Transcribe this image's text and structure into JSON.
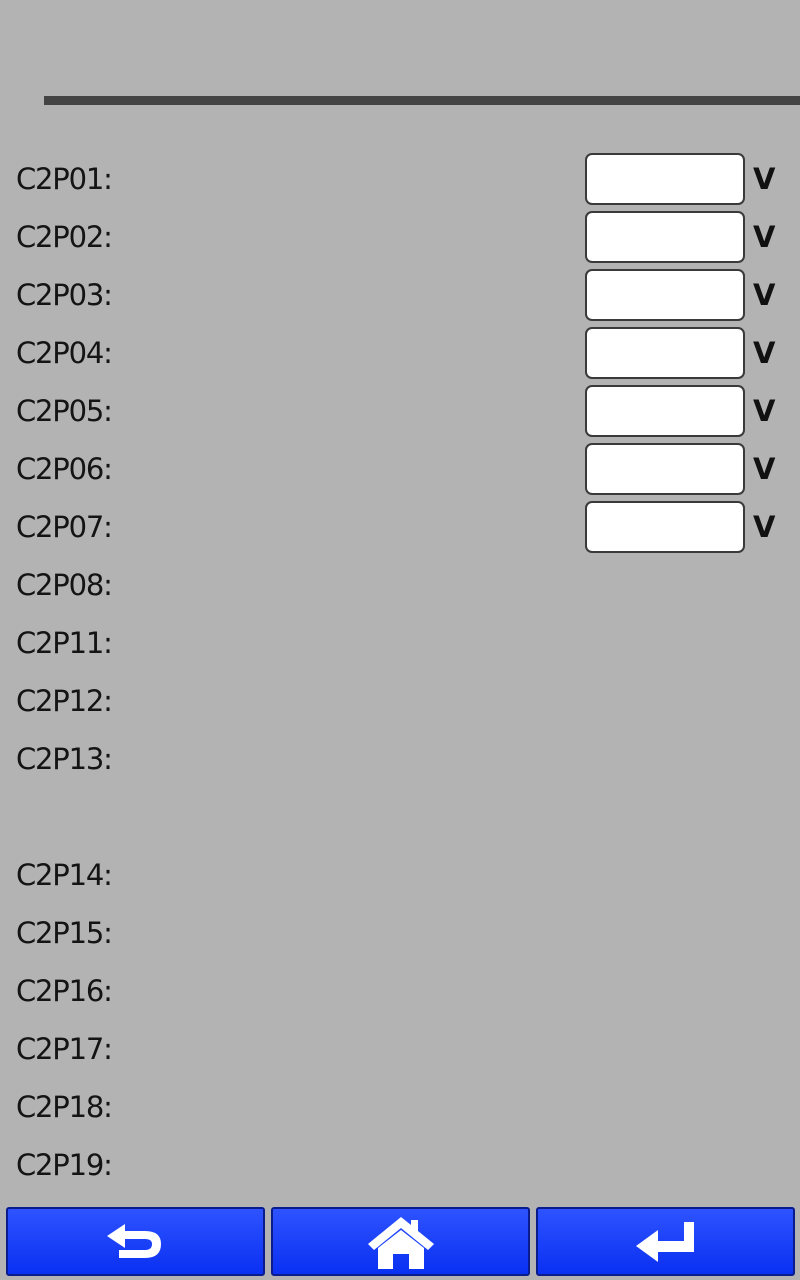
{
  "params": {
    "rows": [
      {
        "label": "C2P01:",
        "value": "",
        "unit": "V"
      },
      {
        "label": "C2P02:",
        "value": "",
        "unit": "V"
      },
      {
        "label": "C2P03:",
        "value": "",
        "unit": "V"
      },
      {
        "label": "C2P04:",
        "value": "",
        "unit": "V"
      },
      {
        "label": "C2P05:",
        "value": "",
        "unit": "V"
      },
      {
        "label": "C2P06:",
        "value": "",
        "unit": "V"
      },
      {
        "label": "C2P07:",
        "value": "",
        "unit": "V"
      },
      {
        "label": "C2P08:"
      },
      {
        "label": "C2P11:"
      },
      {
        "label": "C2P12:"
      },
      {
        "label": "C2P13:"
      },
      {
        "label": "C2P14:"
      },
      {
        "label": "C2P15:"
      },
      {
        "label": "C2P16:"
      },
      {
        "label": "C2P17:"
      },
      {
        "label": "C2P18:"
      },
      {
        "label": "C2P19:"
      }
    ]
  },
  "nav": {
    "buttons": [
      {
        "icon": "back-arrow-icon"
      },
      {
        "icon": "home-icon"
      },
      {
        "icon": "enter-icon"
      }
    ],
    "color": "#1a3fff",
    "icon_color": "#ffffff"
  },
  "colors": {
    "background": "#b3b3b3",
    "divider": "#444444",
    "field_background": "#ffffff"
  }
}
